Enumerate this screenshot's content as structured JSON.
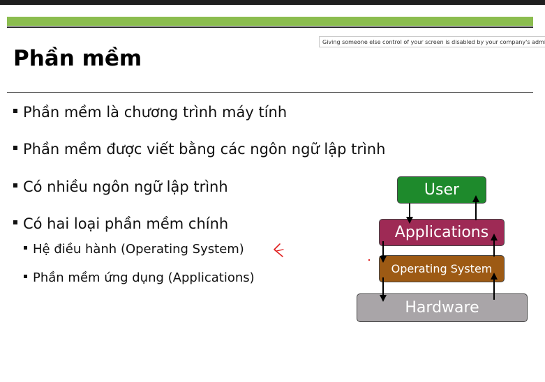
{
  "notice": "Giving someone else control of your screen is disabled by your company's administrator",
  "slide": {
    "title": "Phần mềm",
    "bullets": [
      "Phần mềm là chương trình máy tính",
      "Phần mềm được viết bằng các ngôn ngữ lập trình",
      "Có nhiều ngôn ngữ lập trình",
      "Có hai loại phần mềm chính"
    ],
    "sub_bullets": [
      "Hệ điều hành (Operating System)",
      "Phần mềm ứng dụng (Applications)"
    ],
    "diagram": {
      "user": "User",
      "applications": "Applications",
      "operating_system": "Operating System",
      "hardware": "Hardware"
    }
  },
  "colors": {
    "accent_bar": "#8bbd4f",
    "user": "#1e8a2c",
    "applications": "#9e2a55",
    "operating_system": "#9d5a14",
    "hardware": "#a9a5a8",
    "annotation": "#e02020"
  }
}
